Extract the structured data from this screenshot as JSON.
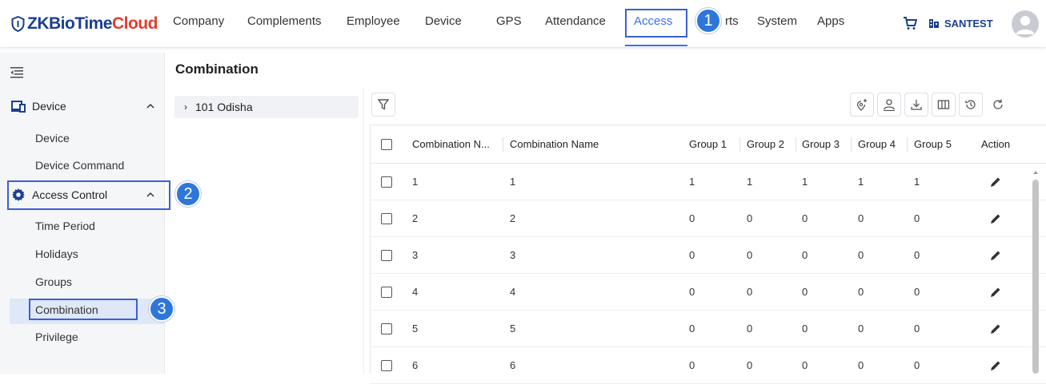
{
  "brand": {
    "zk": "ZKBioTime",
    "cloud": "Cloud"
  },
  "nav": {
    "items": [
      "Company",
      "Complements",
      "Employee",
      "Device",
      "GPS",
      "Attendance",
      "Access",
      "Reports",
      "System",
      "Apps"
    ],
    "active": "Access",
    "reports_visible": "rts"
  },
  "company_name": "SANTEST",
  "annotations": [
    "1",
    "2",
    "3"
  ],
  "sidebar": {
    "groups": [
      {
        "label": "Device",
        "icon": "device-icon",
        "items": [
          "Device",
          "Device Command"
        ]
      },
      {
        "label": "Access Control",
        "icon": "gear-icon",
        "items": [
          "Time Period",
          "Holidays",
          "Groups",
          "Combination",
          "Privilege"
        ]
      }
    ],
    "selected": "Combination"
  },
  "page_title": "Combination",
  "tree": {
    "node": "101 Odisha"
  },
  "table": {
    "columns": [
      "Combination N...",
      "Combination Name",
      "Group 1",
      "Group 2",
      "Group 3",
      "Group 4",
      "Group 5",
      "Action"
    ],
    "rows": [
      [
        "1",
        "1",
        "1",
        "1",
        "1",
        "1",
        "1"
      ],
      [
        "2",
        "2",
        "0",
        "0",
        "0",
        "0",
        "0"
      ],
      [
        "3",
        "3",
        "0",
        "0",
        "0",
        "0",
        "0"
      ],
      [
        "4",
        "4",
        "0",
        "0",
        "0",
        "0",
        "0"
      ],
      [
        "5",
        "5",
        "0",
        "0",
        "0",
        "0",
        "0"
      ],
      [
        "6",
        "6",
        "0",
        "0",
        "0",
        "0",
        "0"
      ]
    ]
  },
  "colors": {
    "accent": "#3a6ee8",
    "annotation": "#2f76db",
    "brand_blue": "#1a3f8f",
    "brand_red": "#e33d2f"
  }
}
